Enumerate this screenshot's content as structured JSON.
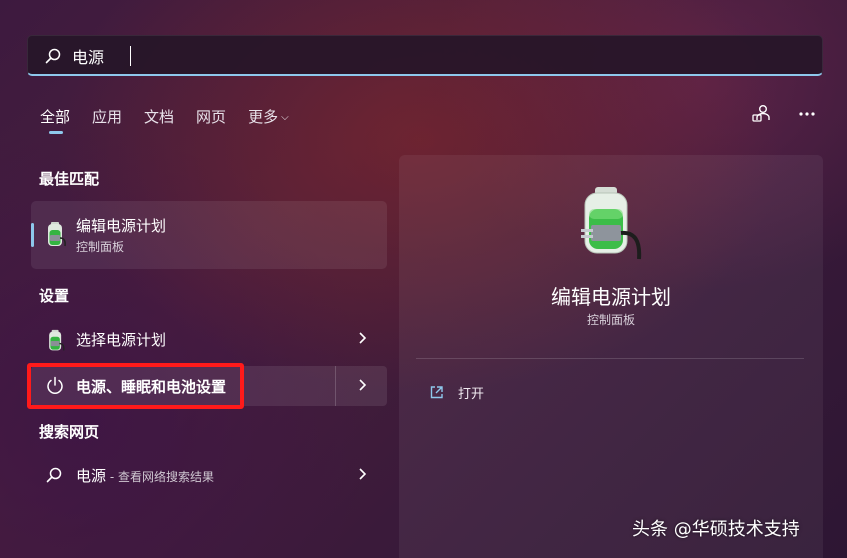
{
  "search": {
    "value": "电源"
  },
  "tabs": [
    {
      "label": "全部",
      "active": true
    },
    {
      "label": "应用"
    },
    {
      "label": "文档"
    },
    {
      "label": "网页"
    },
    {
      "label": "更多"
    }
  ],
  "header_icons": [
    "feedback-person-icon",
    "more-options-icon"
  ],
  "sections": {
    "best_match": "最佳匹配",
    "settings": "设置",
    "web": "搜索网页"
  },
  "best_match": {
    "name": "编辑电源计划",
    "subtitle": "控制面板",
    "icon": "battery-plug-icon"
  },
  "settings_items": [
    {
      "label": "选择电源计划",
      "icon": "battery-plug-icon"
    },
    {
      "label": "电源、睡眠和电池设置",
      "icon": "power-icon",
      "highlighted": true
    }
  ],
  "web_item": {
    "query": "电源",
    "suffix": " - 查看网络搜索结果",
    "icon": "search-icon"
  },
  "preview": {
    "title": "编辑电源计划",
    "subtitle": "控制面板",
    "open_label": "打开"
  },
  "watermark": "头条 @华硕技术支持",
  "colors": {
    "accent": "#8ec8ec",
    "highlight_frame": "#ff1a1a"
  }
}
